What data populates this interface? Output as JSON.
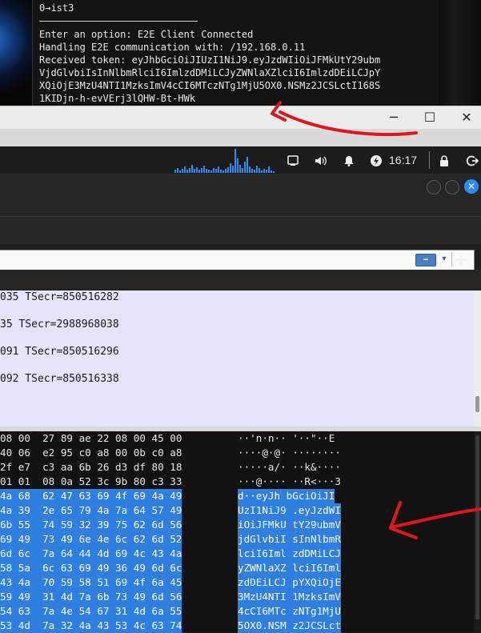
{
  "terminal": {
    "lines": [
      "0→ist3",
      "Enter an option: E2E Client Connected",
      "Handling E2E communication with: /192.168.0.11",
      "Received token: eyJhbGciOiJIUzI1NiJ9.eyJzdWIiOiJFMkUtY29ubm",
      "VjdGlvbiIsInNlbmRlciI6ImlzdDMiLCJyZWNlaXZlciI6ImlzdDEiLCJpY",
      "XQiOjE3MzU4NTI1MzksImV4cCI6MTczNTg1MjU5OX0.NSMz2JCSLctI168S",
      "1KIDjn-h-evVErj3lQHW-Bt-HWk"
    ]
  },
  "window_controls": {
    "minimize": "─",
    "maximize": "☐",
    "close": "✕"
  },
  "panel": {
    "clock": "16:17"
  },
  "icons": {
    "network": "network-icon",
    "volume": "volume-icon",
    "bell": "bell-icon",
    "power": "power-icon",
    "lock": "lock-icon",
    "logout": "logout-icon"
  },
  "filter": {
    "apply_symbol": "➡",
    "dropdown_symbol": "▾",
    "add_symbol": "+"
  },
  "packets": [
    "035 TSecr=850516282",
    "35 TSecr=2988968038",
    "091 TSecr=850516296",
    "092 TSecr=850516338"
  ],
  "hex_rows": [
    {
      "hex": "08 00  27 89 ae 22 08 00 45 00",
      "ascii": "··'n·n·· '··\"··E",
      "selected": false
    },
    {
      "hex": "40 06  e2 95 c0 a8 00 0b c0 a8",
      "ascii": "····@·@· ········",
      "selected": false
    },
    {
      "hex": "2f e7  c3 aa 6b 26 d3 df 80 18",
      "ascii": "·····a/· ··k&····",
      "selected": false
    },
    {
      "hex": "01 01  08 0a 52 3c 9b 80 c3 33",
      "ascii": "···@···· ··R<···3",
      "selected": false
    },
    {
      "hex": "4a 68  62 47 63 69 4f 69 4a 49",
      "ascii": "d··eyJh bGciOiJI",
      "selected": true
    },
    {
      "hex": "4a 39  2e 65 79 4a 7a 64 57 49",
      "ascii": "UzI1NiJ9 .eyJzdWI",
      "selected": true
    },
    {
      "hex": "6b 55  74 59 32 39 75 62 6d 56",
      "ascii": "iOiJFMkU tY29ubmV",
      "selected": true
    },
    {
      "hex": "69 49  73 49 6e 4e 6c 62 6d 52",
      "ascii": "jdGlvbiI sInNlbmR",
      "selected": true
    },
    {
      "hex": "6d 6c  7a 64 44 4d 69 4c 43 4a",
      "ascii": "lciI6Iml zdDMiLCJ",
      "selected": true
    },
    {
      "hex": "58 5a  6c 63 69 49 36 49 6d 6c",
      "ascii": "yZWNlaXZ lciI6Iml",
      "selected": true
    },
    {
      "hex": "43 4a  70 59 58 51 69 4f 6a 45",
      "ascii": "zdDEiLCJ pYXQiOjE",
      "selected": true
    },
    {
      "hex": "59 49  31 4d 7a 6b 73 49 6d 56",
      "ascii": "3MzU4NTI 1MzksImV",
      "selected": true
    },
    {
      "hex": "54 63  7a 4e 54 67 31 4d 6a 55",
      "ascii": "4cCI6MTc zNTg1MjU",
      "selected": true
    },
    {
      "hex": "53 4d  7a 32 4a 43 53 4c 63 74",
      "ascii": "5OX0.NSM z2JCSLct",
      "selected": true
    }
  ],
  "colors": {
    "selection": "#2f7fe0",
    "packet_bg": "#e4e4fb",
    "annotation": "#e0161d"
  }
}
